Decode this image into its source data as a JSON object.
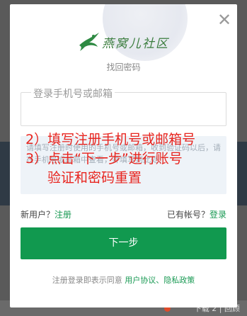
{
  "modal": {
    "close_glyph": "✕",
    "logo_text": "燕窝儿社区",
    "subtitle": "找回密码",
    "input_label": "登录手机号或邮箱",
    "message": "请填写注册时使用的手机号或邮箱，收到验证码以后，请在手机号或邮箱中查看，并填写到此处！",
    "overlay": {
      "line1": "2）填写注册手机号或邮箱号",
      "line2": "3）点击“下一步”进行账号",
      "line3": "验证和密码重置"
    },
    "new_user_prefix": "新用户？",
    "register_link": "注册",
    "has_account_prefix": "已有帐号？",
    "login_link": "登录",
    "next_button": "下一步",
    "agree_prefix": "注册登录即表示同意",
    "agree_links": "用户协议、隐私政策"
  },
  "background": {
    "bottom_text": "下载 2 | 回顾"
  },
  "colors": {
    "accent": "#11994f",
    "link": "#1a9a54",
    "annotation": "#e8251f"
  }
}
